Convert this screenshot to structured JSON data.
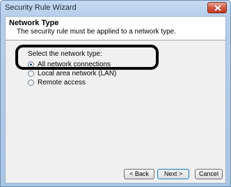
{
  "window": {
    "title": "Security Rule Wizard"
  },
  "header": {
    "title": "Network Type",
    "description": "The security rule must be applied to a network type."
  },
  "body": {
    "prompt": "Select the network type:",
    "options": [
      {
        "label": "All network connections",
        "selected": true
      },
      {
        "label": "Local area network (LAN)",
        "selected": false
      },
      {
        "label": "Remote access",
        "selected": false
      }
    ]
  },
  "buttons": {
    "back": "< Back",
    "next": "Next >",
    "cancel": "Cancel"
  },
  "icons": {
    "close": "close-icon"
  }
}
